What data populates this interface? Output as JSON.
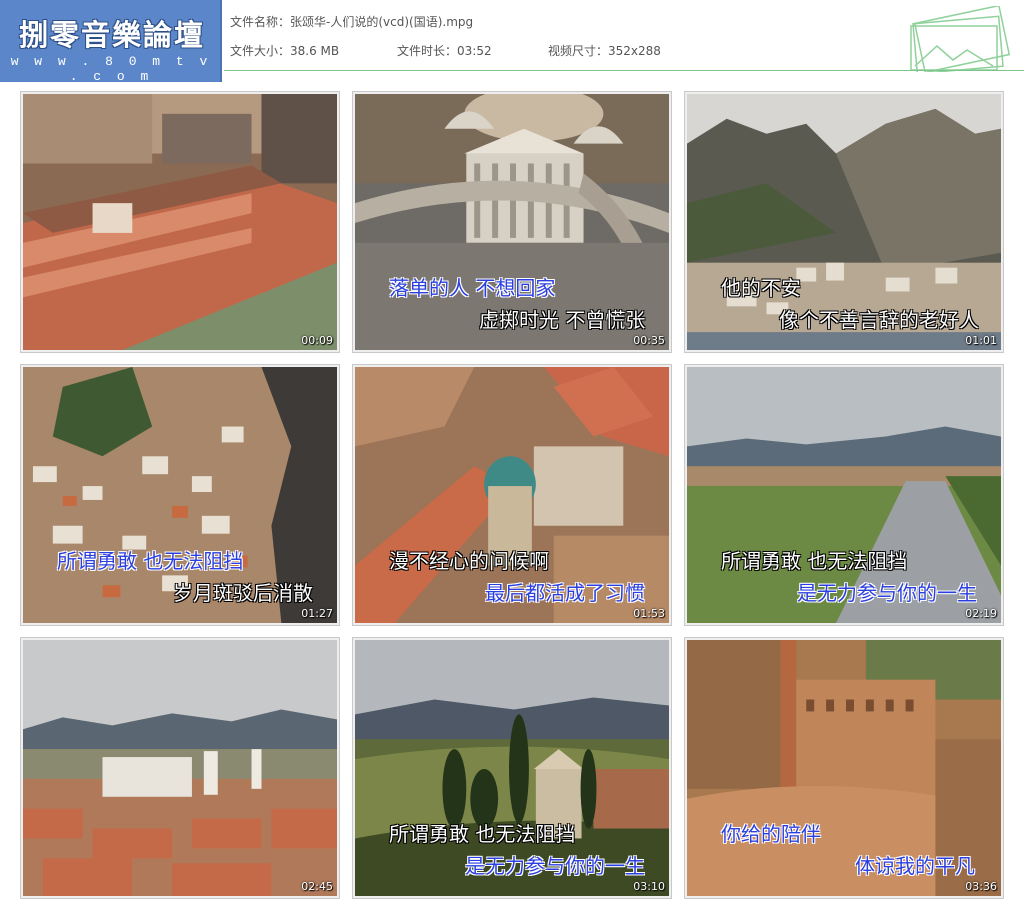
{
  "logo": {
    "title": "捌零音樂論壇",
    "url": "w w w . 8 0 m t v . c o m"
  },
  "file_info": {
    "name_label": "文件名称：",
    "name_value": "张颂华-人们说的(vcd)(国语).mpg",
    "size_label": "文件大小：",
    "size_value": "38.6 MB",
    "duration_label": "文件时长：",
    "duration_value": "03:52",
    "dimension_label": "视频尺寸：",
    "dimension_value": "352x288"
  },
  "thumbnails": [
    {
      "timestamp": "00:09",
      "scene": "palace-aerial",
      "lyric1": "",
      "lyric2": ""
    },
    {
      "timestamp": "00:35",
      "scene": "domed-church-square",
      "lyric1": "落单的人 不想回家",
      "lyric2": "虚掷时光 不曾慌张"
    },
    {
      "timestamp": "01:01",
      "scene": "mountain-coast-town",
      "lyric1": "他的不安",
      "lyric2": "像个不善言辞的老好人"
    },
    {
      "timestamp": "01:27",
      "scene": "hillside-town-coast",
      "lyric1": "所谓勇敢 也无法阻挡",
      "lyric2": "岁月斑驳后消散"
    },
    {
      "timestamp": "01:53",
      "scene": "rooftops-green-dome",
      "lyric1": "漫不经心的问候啊",
      "lyric2": "最后都活成了习惯"
    },
    {
      "timestamp": "02:19",
      "scene": "river-valley",
      "lyric1": "所谓勇敢 也无法阻挡",
      "lyric2": "是无力参与你的一生"
    },
    {
      "timestamp": "02:45",
      "scene": "city-with-tower",
      "lyric1": "",
      "lyric2": ""
    },
    {
      "timestamp": "03:10",
      "scene": "hill-chapel-cypress",
      "lyric1": "所谓勇敢 也无法阻挡",
      "lyric2": "是无力参与你的一生"
    },
    {
      "timestamp": "03:36",
      "scene": "medieval-piazza",
      "lyric1": "你给的陪伴",
      "lyric2": "体谅我的平凡"
    }
  ],
  "colors": {
    "logo_bg": "#5b86c9",
    "rule": "#7cc48b",
    "lyric_blue": "#2b3fe0"
  }
}
